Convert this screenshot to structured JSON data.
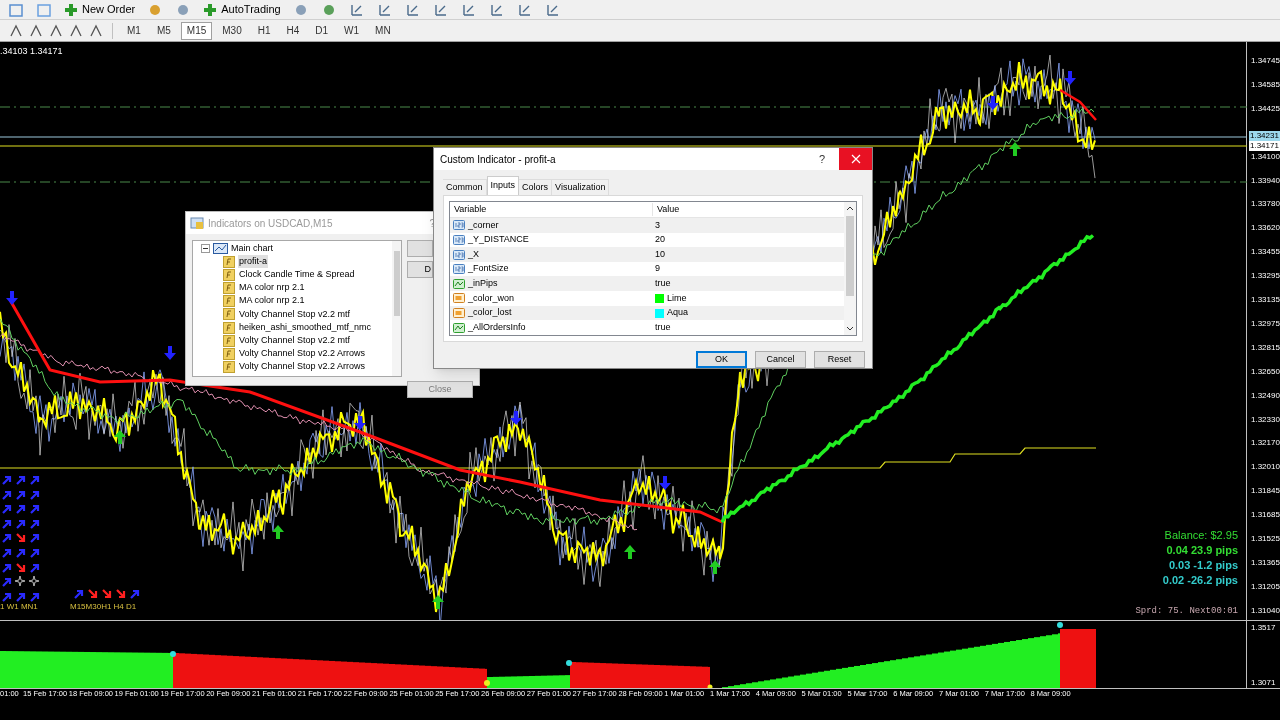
{
  "toolbar": {
    "buttons": [
      "New Order",
      "AutoTrading"
    ],
    "timeframes": [
      {
        "label": "M1",
        "selected": false
      },
      {
        "label": "M5",
        "selected": false
      },
      {
        "label": "M15",
        "selected": true
      },
      {
        "label": "M30",
        "selected": false
      },
      {
        "label": "H1",
        "selected": false
      },
      {
        "label": "H4",
        "selected": false
      },
      {
        "label": "D1",
        "selected": false
      },
      {
        "label": "W1",
        "selected": false
      },
      {
        "label": "MN",
        "selected": false
      }
    ]
  },
  "chart": {
    "quote": ".34103 1.34171",
    "price_labels": [
      "1.34745",
      "1.34585",
      "1.34425",
      "1.34100",
      "1.33940",
      "1.33780",
      "1.33620",
      "1.33455",
      "1.33295",
      "1.33135",
      "1.32975",
      "1.32815",
      "1.32650",
      "1.32490",
      "1.32330",
      "1.32170",
      "1.32010",
      "1.31845",
      "1.31685",
      "1.31525",
      "1.31365",
      "1.31205",
      "1.31040"
    ],
    "bid_tag": "1.34231",
    "ask_tag": "1.34171",
    "signal_grid": [
      {
        "cells": [
          {
            "kind": "up"
          },
          {
            "kind": "up"
          },
          {
            "kind": "up"
          }
        ]
      },
      {
        "cells": [
          {
            "kind": "up"
          },
          {
            "kind": "up"
          },
          {
            "kind": "up"
          }
        ]
      },
      {
        "cells": [
          {
            "kind": "up"
          },
          {
            "kind": "up"
          },
          {
            "kind": "up"
          }
        ]
      },
      {
        "cells": [
          {
            "kind": "up"
          },
          {
            "kind": "up"
          },
          {
            "kind": "up"
          }
        ]
      },
      {
        "cells": [
          {
            "kind": "up"
          },
          {
            "kind": "down"
          },
          {
            "kind": "up"
          }
        ]
      },
      {
        "cells": [
          {
            "kind": "up"
          },
          {
            "kind": "up"
          },
          {
            "kind": "up"
          }
        ]
      },
      {
        "cells": [
          {
            "kind": "up"
          },
          {
            "kind": "down"
          },
          {
            "kind": "up"
          }
        ]
      },
      {
        "cells": [
          {
            "kind": "up"
          },
          {
            "kind": "star"
          },
          {
            "kind": "star"
          }
        ]
      },
      {
        "cells": [
          {
            "kind": "up"
          },
          {
            "kind": "up"
          },
          {
            "kind": "up"
          }
        ]
      }
    ],
    "signal_grid_label": "1 W1 MN1",
    "signal_row": [
      {
        "kind": "up"
      },
      {
        "kind": "down"
      },
      {
        "kind": "down"
      },
      {
        "kind": "down"
      },
      {
        "kind": "up"
      }
    ],
    "signal_row_label": "M15M30H1 H4 D1",
    "account": {
      "balance": "Balance: $2.95",
      "orders": [
        {
          "text": "0.04 23.9 pips",
          "color": "#33dd33"
        },
        {
          "text": "0.03 -1.2 pips",
          "color": "#33cccc"
        },
        {
          "text": "0.02 -26.2 pips",
          "color": "#33cccc"
        }
      ]
    },
    "spread": "Sprd: 75. Next00:01"
  },
  "indicators_window": {
    "title": "Indicators on USDCAD,M15",
    "help": "?",
    "tree": {
      "label": "Main chart",
      "expanded": true,
      "children": [
        {
          "label": "profit-a",
          "selected": true
        },
        {
          "label": "Clock Candle Time & Spread",
          "selected": false
        },
        {
          "label": "MA color nrp 2.1",
          "selected": false
        },
        {
          "label": "MA color nrp 2.1",
          "selected": false
        },
        {
          "label": "Volty Channel Stop v2.2 mtf",
          "selected": false
        },
        {
          "label": "heiken_ashi_smoothed_mtf_nmc",
          "selected": false
        },
        {
          "label": "Volty Channel Stop v2.2 mtf",
          "selected": false
        },
        {
          "label": "Volty Channel Stop v2.2 Arrows",
          "selected": false
        },
        {
          "label": "Volty Channel Stop v2.2 Arrows",
          "selected": false
        }
      ]
    },
    "buttons": [
      "D",
      "Close"
    ]
  },
  "dialog": {
    "title": "Custom Indicator - profit-a",
    "help": "?",
    "tabs": [
      {
        "label": "Common",
        "selected": false
      },
      {
        "label": "Inputs",
        "selected": true
      },
      {
        "label": "Colors",
        "selected": false
      },
      {
        "label": "Visualization",
        "selected": false
      }
    ],
    "columns": [
      "Variable",
      "Value"
    ],
    "rows": [
      {
        "kind": "int",
        "variable": "_corner",
        "value": "3"
      },
      {
        "kind": "int",
        "variable": "_Y_DISTANCE",
        "value": "20"
      },
      {
        "kind": "int",
        "variable": "_X",
        "value": "10"
      },
      {
        "kind": "int",
        "variable": "_FontSize",
        "value": "9"
      },
      {
        "kind": "bool",
        "variable": "_inPips",
        "value": "true"
      },
      {
        "kind": "color",
        "variable": "_color_won",
        "value": "Lime",
        "color": "#00ff00"
      },
      {
        "kind": "color",
        "variable": "_color_lost",
        "value": "Aqua",
        "color": "#00ffff"
      },
      {
        "kind": "bool",
        "variable": "_AllOrdersInfo",
        "value": "true"
      }
    ],
    "buttons": [
      {
        "label": "OK",
        "default": true
      },
      {
        "label": "Cancel",
        "default": false
      },
      {
        "label": "Reset",
        "default": false
      }
    ]
  },
  "subwindow": {
    "scale_labels": [
      "1.3517",
      "1.3071"
    ]
  },
  "time_axis": {
    "labels": [
      "01:00",
      "15 Feb 17:00",
      "18 Feb 09:00",
      "19 Feb 01:00",
      "19 Feb 17:00",
      "20 Feb 09:00",
      "21 Feb 01:00",
      "21 Feb 17:00",
      "22 Feb 09:00",
      "25 Feb 01:00",
      "25 Feb 17:00",
      "26 Feb 09:00",
      "27 Feb 01:00",
      "27 Feb 17:00",
      "28 Feb 09:00",
      "1 Mar 01:00",
      "1 Mar 17:00",
      "4 Mar 09:00",
      "5 Mar 01:00",
      "5 Mar 17:00",
      "6 Mar 09:00",
      "7 Mar 01:00",
      "7 Mar 17:00",
      "8 Mar 09:00"
    ]
  }
}
